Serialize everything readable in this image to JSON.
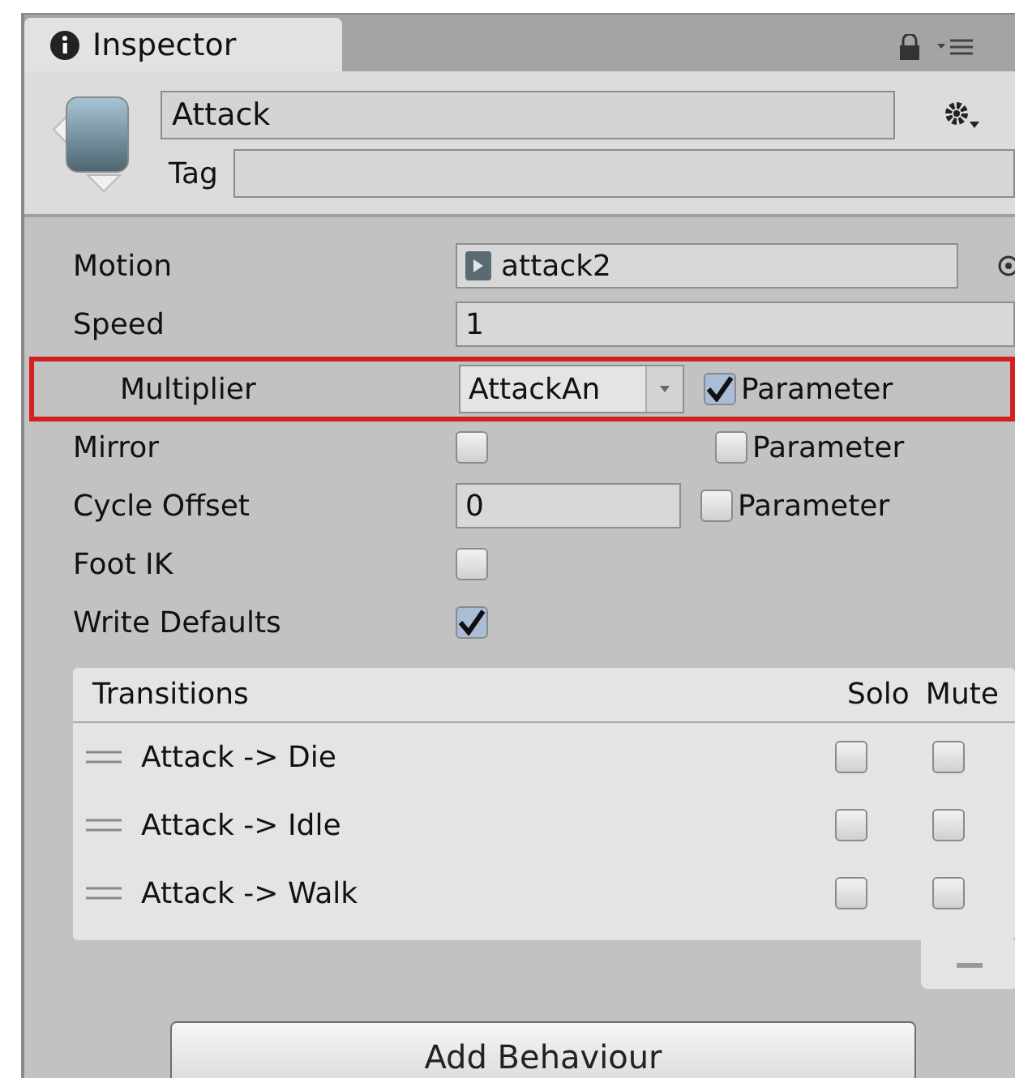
{
  "tab": {
    "label": "Inspector"
  },
  "header": {
    "name": "Attack",
    "tag_label": "Tag"
  },
  "properties": [
    {
      "kind": "object",
      "label": "Motion",
      "value": "attack2"
    },
    {
      "kind": "text",
      "label": "Speed",
      "value": "1",
      "children": [
        {
          "kind": "dropdown",
          "label": "Multiplier",
          "value": "AttackAn",
          "highlighted": true,
          "parameter": {
            "label": "Parameter",
            "checked": true
          }
        }
      ]
    },
    {
      "kind": "checkbox",
      "label": "Mirror",
      "checked": false,
      "parameter": {
        "label": "Parameter",
        "checked": false
      }
    },
    {
      "kind": "short_text",
      "label": "Cycle Offset",
      "value": "0",
      "parameter": {
        "label": "Parameter",
        "checked": false
      }
    },
    {
      "kind": "checkbox",
      "label": "Foot IK",
      "checked": false
    },
    {
      "kind": "checkbox",
      "label": "Write Defaults",
      "checked": true
    }
  ],
  "transitions": {
    "title": "Transitions",
    "columns": [
      "Solo",
      "Mute"
    ],
    "rows": [
      {
        "label": "Attack -> Die",
        "solo": false,
        "mute": false
      },
      {
        "label": "Attack -> Idle",
        "solo": false,
        "mute": false
      },
      {
        "label": "Attack -> Walk",
        "solo": false,
        "mute": false
      }
    ]
  },
  "add_button": "Add Behaviour"
}
